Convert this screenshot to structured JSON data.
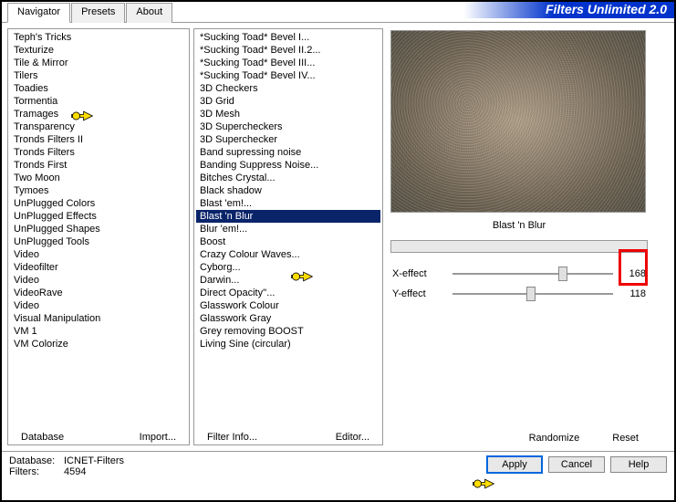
{
  "app_title": "Filters Unlimited 2.0",
  "tabs": {
    "navigator": "Navigator",
    "presets": "Presets",
    "about": "About",
    "active_index": 0
  },
  "categories": [
    "Teph's Tricks",
    "Texturize",
    "Tile & Mirror",
    "Tilers",
    "Toadies",
    "Tormentia",
    "Tramages",
    "Transparency",
    "Tronds Filters II",
    "Tronds Filters",
    "Tronds First",
    "Two Moon",
    "Tymoes",
    "UnPlugged Colors",
    "UnPlugged Effects",
    "UnPlugged Shapes",
    "UnPlugged Tools",
    "Video",
    "Videofilter",
    "Video",
    "VideoRave",
    "Video",
    "Visual Manipulation",
    "VM 1",
    "VM Colorize"
  ],
  "categories_selected": "Toadies",
  "filters": [
    "*Sucking Toad*  Bevel I...",
    "*Sucking Toad*  Bevel II.2...",
    "*Sucking Toad*  Bevel III...",
    "*Sucking Toad*  Bevel IV...",
    "3D Checkers",
    "3D Grid",
    "3D Mesh",
    "3D Supercheckers",
    "3D Superchecker",
    "Band supressing noise",
    "Banding Suppress Noise...",
    "Bitches Crystal...",
    "Black shadow",
    "Blast 'em!...",
    "Blast 'n Blur",
    "Blur 'em!...",
    "Boost",
    "Crazy Colour Waves...",
    "Cyborg...",
    "Darwin...",
    "Direct Opacity''...",
    "Glasswork Colour",
    "Glasswork Gray",
    "Grey removing BOOST",
    "Living Sine (circular)"
  ],
  "filters_selected": "Blast 'n Blur",
  "col1_buttons": {
    "database": "Database",
    "import": "Import..."
  },
  "col2_buttons": {
    "filter_info": "Filter Info...",
    "editor": "Editor..."
  },
  "preview_name": "Blast 'n Blur",
  "params": {
    "x": {
      "label": "X-effect",
      "value": "168",
      "pos": 66
    },
    "y": {
      "label": "Y-effect",
      "value": "118",
      "pos": 46
    }
  },
  "right_buttons": {
    "randomize": "Randomize",
    "reset": "Reset"
  },
  "footer": {
    "db_label": "Database:",
    "db_value": "ICNET-Filters",
    "filters_label": "Filters:",
    "filters_value": "4594",
    "apply": "Apply",
    "cancel": "Cancel",
    "help": "Help"
  }
}
